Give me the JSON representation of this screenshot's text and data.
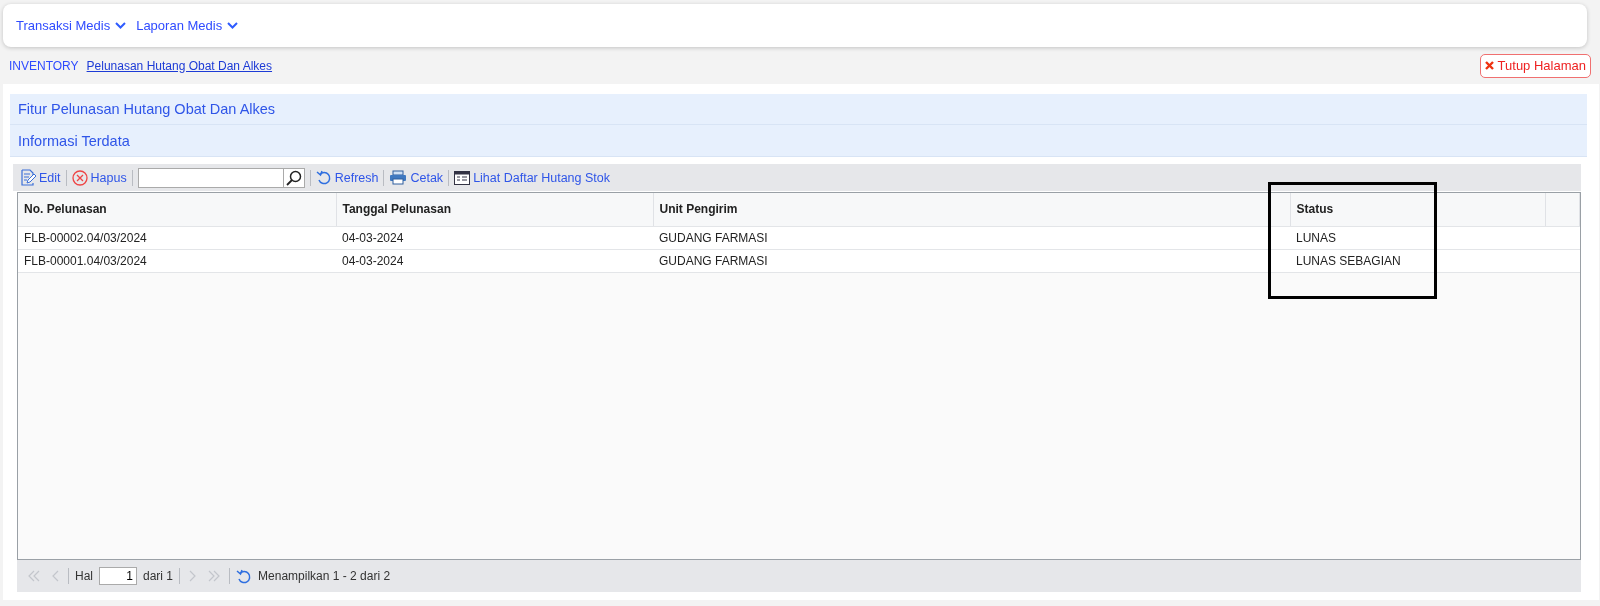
{
  "menu": [
    {
      "label": "Transaksi Medis"
    },
    {
      "label": "Laporan Medis"
    }
  ],
  "breadcrumb": {
    "section": "INVENTORY",
    "page": "Pelunasan Hutang Obat Dan Alkes"
  },
  "close_button": "Tutup Halaman",
  "panel_title": "Fitur Pelunasan Hutang Obat Dan Alkes",
  "section_title": "Informasi Terdata",
  "toolbar": [
    {
      "kind": "edit",
      "label": "Edit"
    },
    {
      "kind": "delete",
      "label": "Hapus"
    },
    {
      "kind": "search"
    },
    {
      "kind": "refresh",
      "label": "Refresh"
    },
    {
      "kind": "print",
      "label": "Cetak"
    },
    {
      "kind": "list",
      "label": "Lihat Daftar Hutang Stok"
    }
  ],
  "table": {
    "columns": [
      "No. Pelunasan",
      "Tanggal Pelunasan",
      "Unit Pengirim",
      "Status"
    ],
    "rows": [
      [
        "FLB-00002.04/03/2024",
        "04-03-2024",
        "GUDANG FARMASI",
        "LUNAS"
      ],
      [
        "FLB-00001.04/03/2024",
        "04-03-2024",
        "GUDANG FARMASI",
        "LUNAS SEBAGIAN"
      ]
    ]
  },
  "pager": {
    "nav": [
      {
        "kind": "first",
        "disabled": true
      },
      {
        "kind": "prev",
        "disabled": true
      },
      {
        "kind": "next",
        "disabled": true
      },
      {
        "kind": "last",
        "disabled": true
      }
    ],
    "page_label": "Hal",
    "page": "1",
    "total_label": "dari 1",
    "summary": "Menampilkan 1 - 2 dari 2"
  }
}
